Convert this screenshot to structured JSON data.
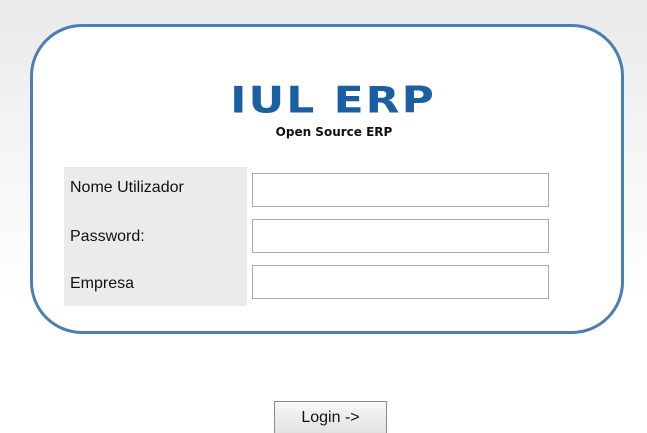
{
  "logo": {
    "title": "IUL ERP",
    "subtitle": "Open Source ERP",
    "color": "#1a5fa3"
  },
  "form": {
    "fields": [
      {
        "label": "Nome Utilizador",
        "value": "",
        "placeholder": ""
      },
      {
        "label": "Password:",
        "value": "",
        "placeholder": ""
      },
      {
        "label": "Empresa",
        "value": "",
        "placeholder": ""
      }
    ]
  },
  "login_button": {
    "label": "Login ->"
  },
  "colors": {
    "border": "#4a7fb5",
    "label_background": "#ebebeb"
  }
}
